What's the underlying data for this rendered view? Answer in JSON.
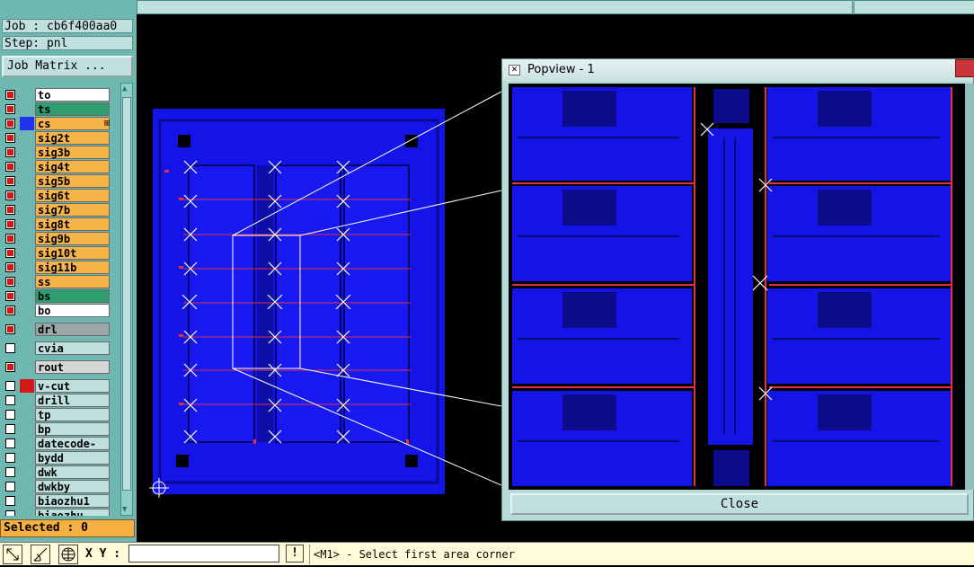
{
  "info": {
    "job": "Job : cb6f400aa0",
    "step": "Step: pnl"
  },
  "job_matrix_label": "Job Matrix ...",
  "layers": [
    {
      "name": "to",
      "checked": true,
      "swatch": "",
      "bg": "#ffffff"
    },
    {
      "name": "ts",
      "checked": true,
      "swatch": "",
      "bg": "#2e9d6f"
    },
    {
      "name": "cs",
      "checked": true,
      "swatch": "#2233ee",
      "bg": "#f6b449",
      "marker": "⊞"
    },
    {
      "name": "sig2t",
      "checked": true,
      "swatch": "",
      "bg": "#f6b449"
    },
    {
      "name": "sig3b",
      "checked": true,
      "swatch": "",
      "bg": "#f6b449"
    },
    {
      "name": "sig4t",
      "checked": true,
      "swatch": "",
      "bg": "#f6b449"
    },
    {
      "name": "sig5b",
      "checked": true,
      "swatch": "",
      "bg": "#f6b449"
    },
    {
      "name": "sig6t",
      "checked": true,
      "swatch": "",
      "bg": "#f6b449"
    },
    {
      "name": "sig7b",
      "checked": true,
      "swatch": "",
      "bg": "#f6b449"
    },
    {
      "name": "sig8t",
      "checked": true,
      "swatch": "",
      "bg": "#f6b449"
    },
    {
      "name": "sig9b",
      "checked": true,
      "swatch": "",
      "bg": "#f6b449"
    },
    {
      "name": "sig10t",
      "checked": true,
      "swatch": "",
      "bg": "#f6b449"
    },
    {
      "name": "sig11b",
      "checked": true,
      "swatch": "",
      "bg": "#f6b449"
    },
    {
      "name": "ss",
      "checked": true,
      "swatch": "",
      "bg": "#f6b449"
    },
    {
      "name": "bs",
      "checked": true,
      "swatch": "",
      "bg": "#2e9d6f"
    },
    {
      "name": "bo",
      "checked": true,
      "swatch": "",
      "bg": "#ffffff"
    },
    {
      "name": "drl",
      "checked": true,
      "swatch": "",
      "bg": "#9aa7a6"
    },
    {
      "name": "cvia",
      "checked": false,
      "swatch": "",
      "bg": "#bfe0de"
    },
    {
      "name": "rout",
      "checked": true,
      "swatch": "",
      "bg": "#d6d6d6"
    },
    {
      "name": "v-cut",
      "checked": false,
      "swatch": "#d21818",
      "bg": "#bfe0de"
    },
    {
      "name": "drill",
      "checked": false,
      "swatch": "",
      "bg": "#bfe0de"
    },
    {
      "name": "tp",
      "checked": false,
      "swatch": "",
      "bg": "#bfe0de"
    },
    {
      "name": "bp",
      "checked": false,
      "swatch": "",
      "bg": "#bfe0de"
    },
    {
      "name": "datecode-to",
      "checked": false,
      "swatch": "",
      "bg": "#bfe0de"
    },
    {
      "name": "bydd",
      "checked": false,
      "swatch": "",
      "bg": "#bfe0de"
    },
    {
      "name": "dwk",
      "checked": false,
      "swatch": "",
      "bg": "#bfe0de"
    },
    {
      "name": "dwkby",
      "checked": false,
      "swatch": "",
      "bg": "#bfe0de"
    },
    {
      "name": "biaozhu1",
      "checked": false,
      "swatch": "",
      "bg": "#bfe0de"
    },
    {
      "name": "biaozhu",
      "checked": false,
      "swatch": "",
      "bg": "#bfe0de"
    }
  ],
  "selected_label": "Selected : 0",
  "xy_label": "X Y :",
  "xy_value": "",
  "warn_glyph": "!",
  "prompt_text": "<M1> - Select first area corner",
  "popview": {
    "title": "Popview - 1",
    "close_label": "Close"
  },
  "colors": {
    "board_blue": "#1414e8",
    "board_dark": "#0a0a90",
    "route_red": "#e0304a",
    "panel_teal": "#6fb7b1"
  }
}
